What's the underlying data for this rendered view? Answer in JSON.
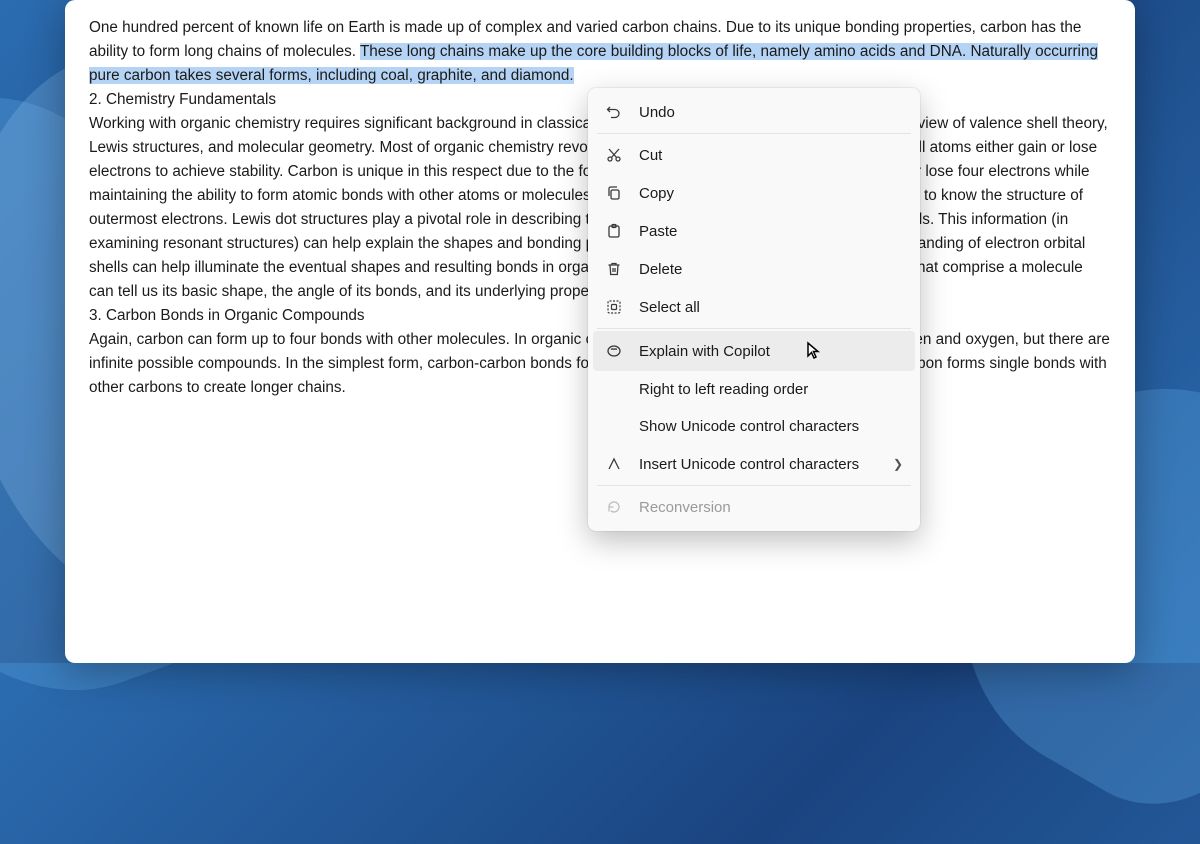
{
  "doc": {
    "p1_before": "One hundred percent of known life on Earth is made up of complex and varied carbon chains. Due to its unique bonding properties, carbon has the ability to form long chains of molecules. ",
    "p1_selected": "These long chains make up the core building blocks of life, namely amino acids and DNA. Naturally occurring pure carbon takes several forms, including coal, graphite, and diamond.",
    "h2": "2. Chemistry Fundamentals",
    "p2": "Working with organic chemistry requires significant background in classical chemistry principles. Here we provide a brief review of valence shell theory, Lewis structures, and molecular geometry. Most of organic chemistry revolves around valence shell theory—the idea that all atoms either gain or lose electrons to achieve stability. Carbon is unique in this respect due to the four electrons in its outer shell. It can either gain or lose four electrons while maintaining the ability to form atomic bonds with other atoms or molecules. To describe organic molecules' bonds, we need to know the structure of outermost electrons. Lewis dot structures play a pivotal role in describing the paired and unpaired electrons in valence shells. This information (in examining resonant structures) can help explain the shapes and bonding possibilities within a molecule. Finally, an understanding of electron orbital shells can help illuminate the eventual shapes and resulting bonds in organic compounds. The number and type of bonds that comprise a molecule can tell us its basic shape, the angle of its bonds, and its underlying properties.",
    "h3": "3. Carbon Bonds in Organic Compounds",
    "p3": "Again, carbon can form up to four bonds with other molecules. In organic chemistry, carbon often forms bonds with hydrogen and oxygen, but there are infinite possible compounds. In the simplest form, carbon-carbon bonds form single covalent bonds. In other instances, carbon forms single bonds with other carbons to create longer chains."
  },
  "menu": {
    "undo": "Undo",
    "cut": "Cut",
    "copy": "Copy",
    "paste": "Paste",
    "delete": "Delete",
    "select_all": "Select all",
    "explain": "Explain with Copilot",
    "rtl": "Right to left reading order",
    "show_unicode": "Show Unicode control characters",
    "insert_unicode": "Insert Unicode control characters",
    "reconversion": "Reconversion"
  }
}
